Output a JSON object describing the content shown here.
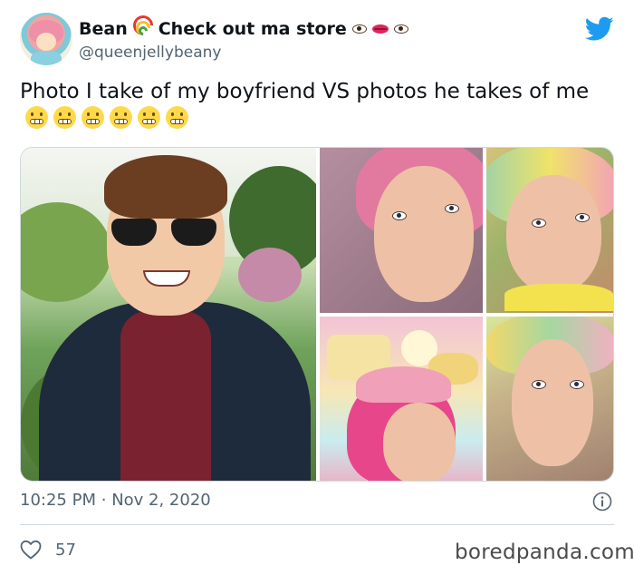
{
  "author": {
    "display_name": "Bean",
    "display_name_suffix": "Check out ma store",
    "handle": "@queenjellybeany",
    "emojis": [
      "rainbow-emoji",
      "eye-emoji",
      "lips-emoji",
      "eye-emoji"
    ]
  },
  "tweet": {
    "text": "Photo I take of my boyfriend VS photos he takes of me",
    "trailing_emoji": "grimacing-face",
    "trailing_emoji_count": 6
  },
  "media": {
    "photos": [
      {
        "subject": "boyfriend-portrait"
      },
      {
        "subject": "girlfriend-closeup-1"
      },
      {
        "subject": "girlfriend-closeup-2"
      },
      {
        "subject": "girlfriend-closeup-3"
      },
      {
        "subject": "girlfriend-closeup-4"
      }
    ]
  },
  "meta": {
    "time": "10:25 PM",
    "separator": "·",
    "date": "Nov 2, 2020",
    "likes": "57"
  },
  "watermark": "boredpanda.com",
  "colors": {
    "twitter_blue": "#1d9bf0",
    "text_primary": "#0f1419",
    "text_secondary": "#536471",
    "divider": "#cfd9de"
  }
}
